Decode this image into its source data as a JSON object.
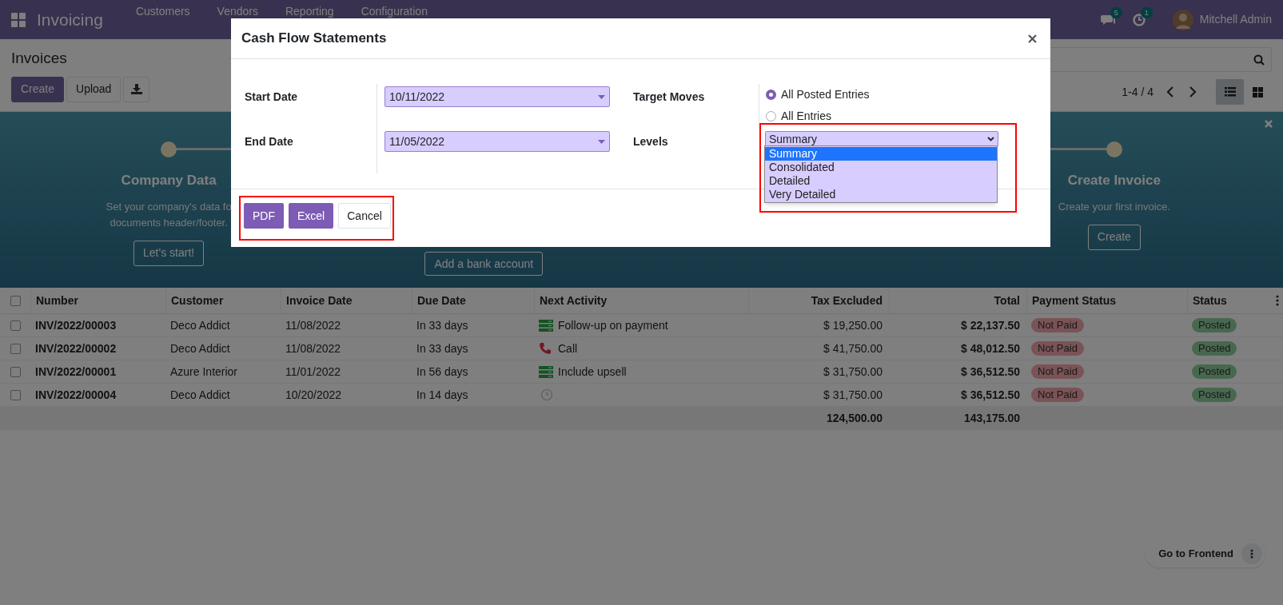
{
  "navbar": {
    "app_title": "Invoicing",
    "menu": [
      "Customers",
      "Vendors",
      "Reporting",
      "Configuration"
    ],
    "messages_count": "5",
    "activities_count": "1",
    "user": "Mitchell Admin"
  },
  "control_panel": {
    "title": "Invoices",
    "buttons": [
      {
        "label": "Create",
        "kind": "primary"
      },
      {
        "label": "Upload",
        "kind": "secondary"
      }
    ],
    "pager": "1-4 / 4",
    "views": [
      {
        "kind": "list",
        "selected": true
      },
      {
        "kind": "kanban",
        "selected": false
      }
    ]
  },
  "onboarding": {
    "steps": [
      {
        "title": "Company Data",
        "lines": [
          "Set your company's data fo",
          "documents header/footer."
        ],
        "button": "Let's start!"
      },
      {
        "button": "Add a bank account"
      },
      {
        "title": "Create Invoice",
        "lines": [
          "Create your first invoice."
        ],
        "button": "Create"
      }
    ]
  },
  "table": {
    "select_all_checked": false,
    "columns": [
      "Number",
      "Customer",
      "Invoice Date",
      "Due Date",
      "Next Activity",
      "Tax Excluded",
      "Total",
      "Payment Status",
      "Status"
    ],
    "rows": [
      {
        "checked": false,
        "number": "INV/2022/00003",
        "customer": "Deco Addict",
        "invoice_date": "11/08/2022",
        "due_date": "In 33 days",
        "activity": {
          "kind": "todo",
          "label": "Follow-up on payment"
        },
        "tax_excluded": "$ 19,250.00",
        "total": "$ 22,137.50",
        "payment_status": "Not Paid",
        "status": "Posted"
      },
      {
        "checked": false,
        "number": "INV/2022/00002",
        "customer": "Deco Addict",
        "invoice_date": "11/08/2022",
        "due_date": "In 33 days",
        "activity": {
          "kind": "call",
          "label": "Call"
        },
        "tax_excluded": "$ 41,750.00",
        "total": "$ 48,012.50",
        "payment_status": "Not Paid",
        "status": "Posted"
      },
      {
        "checked": false,
        "number": "INV/2022/00001",
        "customer": "Azure Interior",
        "invoice_date": "11/01/2022",
        "due_date": "In 56 days",
        "activity": {
          "kind": "todo",
          "label": "Include upsell"
        },
        "tax_excluded": "$ 31,750.00",
        "total": "$ 36,512.50",
        "payment_status": "Not Paid",
        "status": "Posted"
      },
      {
        "checked": false,
        "number": "INV/2022/00004",
        "customer": "Deco Addict",
        "invoice_date": "10/20/2022",
        "due_date": "In 14 days",
        "activity": {
          "kind": "none"
        },
        "tax_excluded": "$ 31,750.00",
        "total": "$ 36,512.50",
        "payment_status": "Not Paid",
        "status": "Posted"
      }
    ],
    "totals": {
      "tax_excluded": "124,500.00",
      "total": "143,175.00"
    }
  },
  "dialog": {
    "title": "Cash Flow Statements",
    "start_date": {
      "label": "Start Date",
      "value": "10/11/2022"
    },
    "end_date": {
      "label": "End Date",
      "value": "11/05/2022"
    },
    "target_moves": {
      "label": "Target Moves",
      "options": [
        {
          "label": "All Posted Entries",
          "selected": true
        },
        {
          "label": "All Entries",
          "selected": false
        }
      ]
    },
    "levels": {
      "label": "Levels",
      "value": "Summary",
      "options": [
        {
          "label": "Summary",
          "selected": true
        },
        {
          "label": "Consolidated",
          "selected": false
        },
        {
          "label": "Detailed",
          "selected": false
        },
        {
          "label": "Very Detailed",
          "selected": false
        }
      ]
    },
    "buttons": [
      {
        "label": "PDF",
        "kind": "primary"
      },
      {
        "label": "Excel",
        "kind": "primary"
      },
      {
        "label": "Cancel",
        "kind": "secondary"
      }
    ]
  },
  "floating": {
    "label": "Go to Frontend"
  }
}
